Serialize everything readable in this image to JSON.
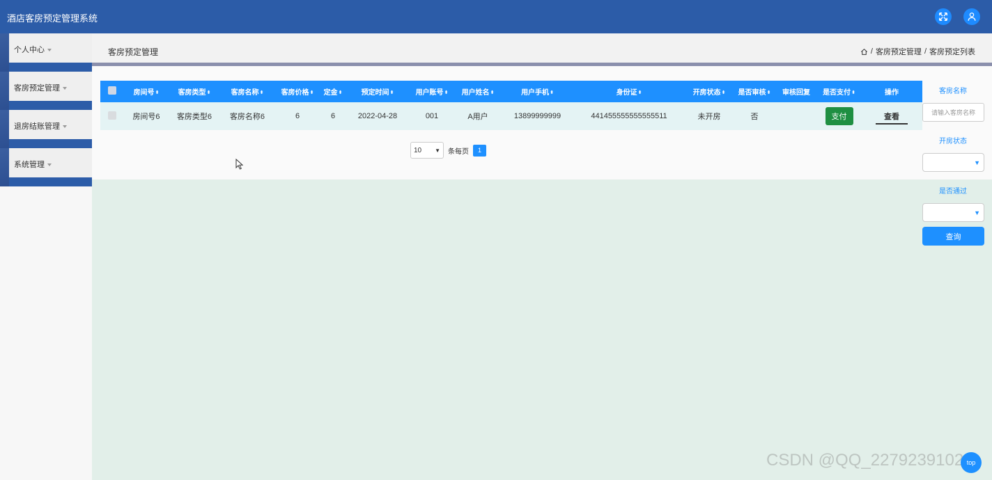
{
  "app": {
    "title": "酒店客房预定管理系统"
  },
  "header_icons": {
    "fullscreen": "fullscreen-icon",
    "user": "user-icon"
  },
  "sidebar": {
    "items": [
      {
        "label": "个人中心"
      },
      {
        "label": "客房预定管理"
      },
      {
        "label": "退房结账管理"
      },
      {
        "label": "系统管理"
      }
    ]
  },
  "breadcrumb": {
    "page_title": "客房预定管理",
    "home_icon": "home-icon",
    "sep": "/",
    "items": [
      "客房预定管理",
      "客房预定列表"
    ]
  },
  "table": {
    "columns": [
      "房间号",
      "客房类型",
      "客房名称",
      "客房价格",
      "定金",
      "预定时间",
      "用户账号",
      "用户姓名",
      "用户手机",
      "身份证",
      "开房状态",
      "是否审核",
      "审核回复",
      "是否支付",
      "操作"
    ],
    "sortable": [
      true,
      true,
      true,
      true,
      true,
      true,
      true,
      true,
      true,
      true,
      true,
      true,
      false,
      true,
      false
    ],
    "sort_glyph": "⬍",
    "rows": [
      {
        "room_no": "房间号6",
        "room_type": "客房类型6",
        "room_name": "客房名称6",
        "price": "6",
        "deposit": "6",
        "date": "2022-04-28",
        "account": "001",
        "user_name": "A用户",
        "phone": "13899999999",
        "id_card": "441455555555555511",
        "open_status": "未开房",
        "audited": "否",
        "audit_reply": "",
        "pay_label": "支付",
        "view_label": "查看"
      }
    ]
  },
  "pagination": {
    "page_size": "10",
    "per_page_text": "条每页",
    "current_page": "1"
  },
  "filters": {
    "room_name_label": "客房名称",
    "room_name_placeholder": "请输入客房名称",
    "open_status_label": "开房状态",
    "open_status_value": "",
    "passed_label": "是否通过",
    "passed_value": "",
    "query_label": "查询"
  },
  "watermark": "CSDN @QQ_2279239102",
  "fab": {
    "label": "top"
  },
  "colors": {
    "header": "#2c5ca8",
    "accent": "#1e90ff",
    "pay": "#1f8f42",
    "table_row": "#e4f3f4"
  }
}
